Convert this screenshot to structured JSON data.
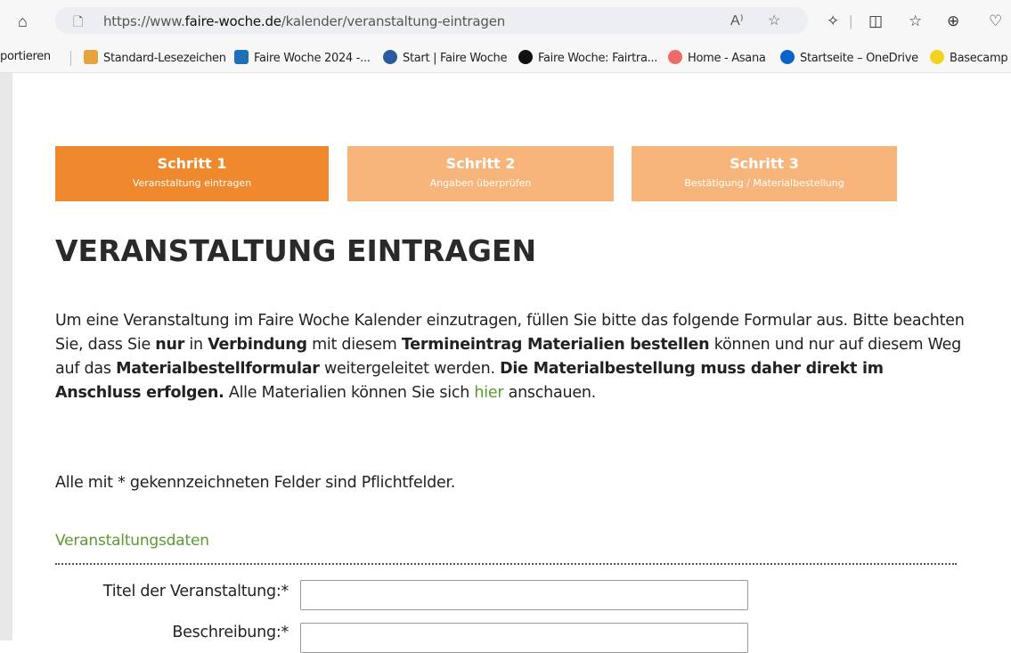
{
  "browser": {
    "url_prefix": "https://www.",
    "url_domain": "faire-woche.de",
    "url_path": "/kalender/veranstaltung-eintragen",
    "bookmarks": [
      {
        "label": "portieren"
      },
      {
        "label": "Standard-Lesezeichen",
        "color": "#e6a23c"
      },
      {
        "label": "Faire Woche 2024 -...",
        "color": "#1f6fb8"
      },
      {
        "label": "Start | Faire Woche",
        "color": "#2c5aa0"
      },
      {
        "label": "Faire Woche: Fairtra...",
        "color": "#111111"
      },
      {
        "label": "Home - Asana",
        "color": "#f06a6a"
      },
      {
        "label": "Startseite – OneDrive",
        "color": "#0a64c8"
      },
      {
        "label": "Basecamp",
        "color": "#f1d320"
      }
    ]
  },
  "steps": [
    {
      "title": "Schritt 1",
      "subtitle": "Veranstaltung eintragen"
    },
    {
      "title": "Schritt 2",
      "subtitle": "Angaben überprüfen"
    },
    {
      "title": "Schritt 3",
      "subtitle": "Bestätigung / Materialbestellung"
    }
  ],
  "heading": "VERANSTALTUNG EINTRAGEN",
  "intro": {
    "p1": "Um eine Veranstaltung im Faire Woche Kalender einzutragen, füllen Sie bitte das folgende Formular aus. Bitte beachten Sie, dass Sie ",
    "b1": "nur",
    "p2": " in ",
    "b2": "Verbindung",
    "p3": " mit diesem ",
    "b3": "Termineintrag Materialien bestellen",
    "p4": " können und nur auf diesem Weg auf das ",
    "b4": "Materialbestellformular",
    "p5": " weitergeleitet werden. ",
    "b5": "Die Materialbestellung muss daher direkt im Anschluss erfolgen.",
    "p6": " Alle Materialien können Sie sich ",
    "link": "hier",
    "p7": " anschauen."
  },
  "required_note": "Alle mit * gekennzeichneten Felder sind Pflichtfelder.",
  "section_title": "Veranstaltungsdaten",
  "form": {
    "title_label": "Titel der Veranstaltung:*",
    "title_value": "",
    "desc_label": "Beschreibung:*",
    "desc_value": ""
  },
  "colors": {
    "step_active": "#f0892d",
    "step_inactive": "#f7b57c",
    "accent_green": "#5a9a2f"
  }
}
